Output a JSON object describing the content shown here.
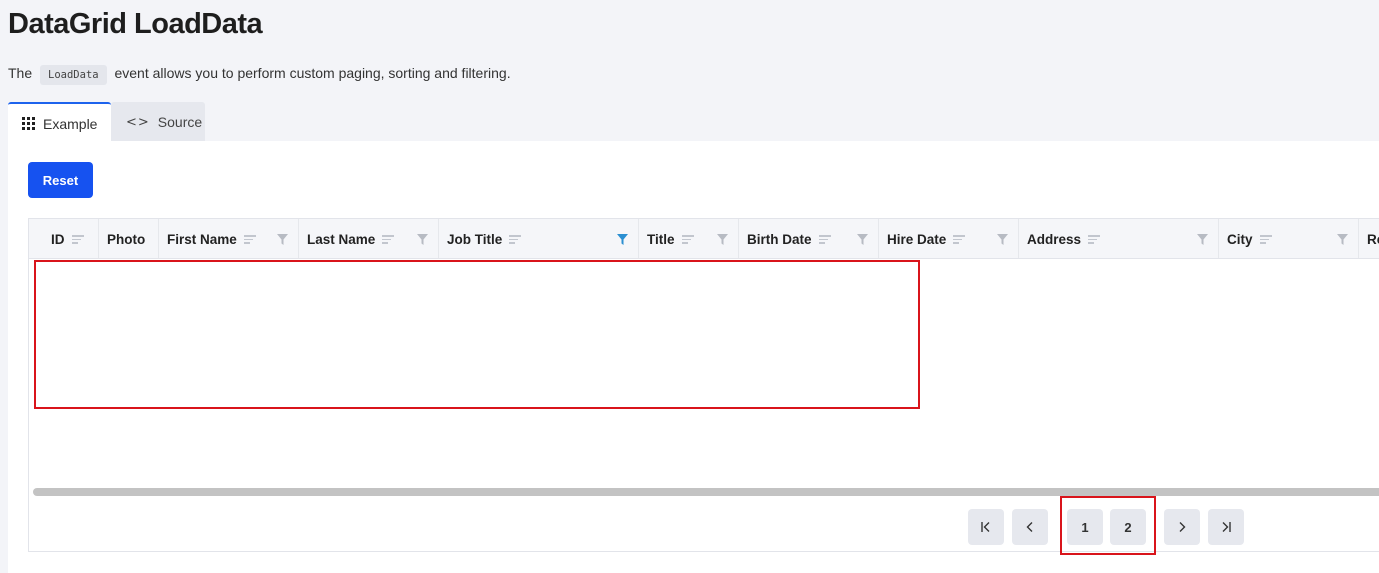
{
  "page": {
    "title": "DataGrid LoadData",
    "description_before": "The",
    "description_code": "LoadData",
    "description_after": "event allows you to perform custom paging, sorting and filtering."
  },
  "tabs": [
    {
      "label": "Example",
      "icon": "grid-icon",
      "active": true
    },
    {
      "label": "Source",
      "icon": "code-icon",
      "active": false
    }
  ],
  "toolbar": {
    "reset_label": "Reset"
  },
  "accent_color": "#1652f0",
  "highlight_color": "#d9141b",
  "grid": {
    "columns": [
      {
        "label": "ID",
        "sortable": true,
        "filter": false
      },
      {
        "label": "Photo",
        "sortable": false,
        "filter": false
      },
      {
        "label": "First Name",
        "sortable": true,
        "filter": true
      },
      {
        "label": "Last Name",
        "sortable": true,
        "filter": true
      },
      {
        "label": "Job Title",
        "sortable": true,
        "filter": true,
        "filter_active": true
      },
      {
        "label": "Title",
        "sortable": true,
        "filter": true
      },
      {
        "label": "Birth Date",
        "sortable": true,
        "filter": true
      },
      {
        "label": "Hire Date",
        "sortable": true,
        "filter": true
      },
      {
        "label": "Address",
        "sortable": true,
        "filter": true
      },
      {
        "label": "City",
        "sortable": true,
        "filter": true
      },
      {
        "label": "Re",
        "sortable": false,
        "filter": false
      }
    ],
    "rows": []
  },
  "pager": {
    "first_icon": "first-page-icon",
    "prev_icon": "prev-page-icon",
    "pages": [
      "1",
      "2"
    ],
    "next_icon": "next-page-icon",
    "last_icon": "last-page-icon"
  }
}
